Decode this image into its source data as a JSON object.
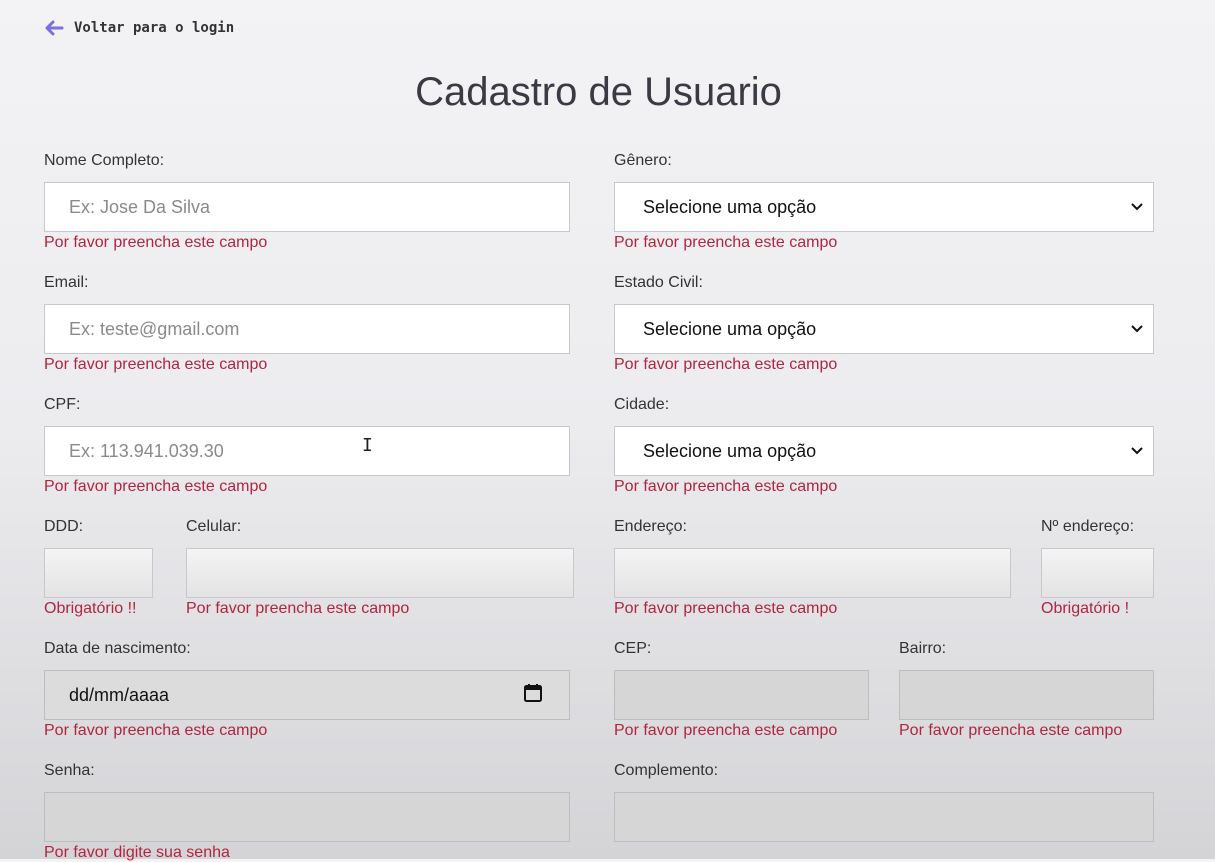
{
  "nav": {
    "back_label": "Voltar para o login"
  },
  "title": "Cadastro de Usuario",
  "form": {
    "nome": {
      "label": "Nome Completo:",
      "placeholder": "Ex: Jose Da Silva",
      "error": "Por favor preencha este campo"
    },
    "genero": {
      "label": "Gênero:",
      "selected": "Selecione uma opção",
      "error": "Por favor preencha este campo"
    },
    "email": {
      "label": "Email:",
      "placeholder": "Ex: teste@gmail.com",
      "error": "Por favor preencha este campo"
    },
    "estado_civil": {
      "label": "Estado Civil:",
      "selected": "Selecione uma opção",
      "error": "Por favor preencha este campo"
    },
    "cpf": {
      "label": "CPF:",
      "placeholder": "Ex: 113.941.039.30",
      "error": "Por favor preencha este campo"
    },
    "cidade": {
      "label": "Cidade:",
      "selected": "Selecione uma opção",
      "error": "Por favor preencha este campo"
    },
    "ddd": {
      "label": "DDD:",
      "error": "Obrigatório !!"
    },
    "celular": {
      "label": "Celular:",
      "error": "Por favor preencha este campo"
    },
    "endereco": {
      "label": "Endereço:",
      "error": "Por favor preencha este campo"
    },
    "num_endereco": {
      "label": "Nº endereço:",
      "error": "Obrigatório !"
    },
    "nascimento": {
      "label": "Data de nascimento:",
      "placeholder": "dd/mm/aaaa",
      "error": "Por favor preencha este campo"
    },
    "cep": {
      "label": "CEP:",
      "error": "Por favor preencha este campo"
    },
    "bairro": {
      "label": "Bairro:",
      "error": "Por favor preencha este campo"
    },
    "senha": {
      "label": "Senha:",
      "error": "Por favor digite sua senha"
    },
    "complemento": {
      "label": "Complemento:"
    }
  },
  "icons": {
    "back": "arrow-left-icon",
    "select": "chevron-down-icon",
    "date": "calendar-icon",
    "cursor": "text-cursor-icon"
  },
  "colors": {
    "accent": "#7b6fe0",
    "error": "#b0253f",
    "title": "#3a3a44"
  }
}
